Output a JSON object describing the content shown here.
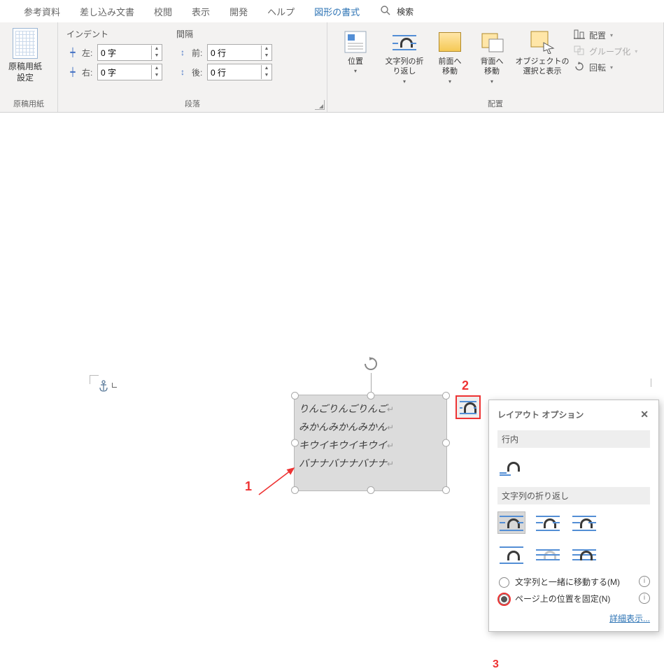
{
  "tabs": {
    "ref": "参考資料",
    "mail": "差し込み文書",
    "review": "校閲",
    "view": "表示",
    "dev": "開発",
    "help": "ヘルプ",
    "format": "図形の書式"
  },
  "search": {
    "label": "検索"
  },
  "groups": {
    "genkou": "原稿用紙",
    "para": "段落",
    "arrange": "配置"
  },
  "genkou": {
    "label": "原稿用紙\n設定"
  },
  "indent": {
    "header": "インデント",
    "left_lab": "左:",
    "right_lab": "右:",
    "left_val": "0 字",
    "right_val": "0 字"
  },
  "spacing": {
    "header": "間隔",
    "before_lab": "前:",
    "after_lab": "後:",
    "before_val": "0 行",
    "after_val": "0 行"
  },
  "arrange": {
    "position": "位置",
    "wrap": "文字列の折\nり返し",
    "front": "前面へ\n移動",
    "back": "背面へ\n移動",
    "selpane": "オブジェクトの\n選択と表示",
    "align": "配置",
    "group": "グループ化",
    "rotate": "回転"
  },
  "textbox": {
    "lines": [
      "りんごりんごりんご",
      "みかんみかんみかん",
      "キウイキウイキウイ",
      "バナナバナナバナナ"
    ]
  },
  "popup": {
    "title": "レイアウト オプション",
    "inline": "行内",
    "wraphead": "文字列の折り返し",
    "opt_move": "文字列と一緒に移動する(M)",
    "opt_fix": "ページ上の位置を固定(N)",
    "details": "詳細表示..."
  },
  "anno": {
    "a1": "1",
    "a2": "2",
    "a3": "3"
  }
}
